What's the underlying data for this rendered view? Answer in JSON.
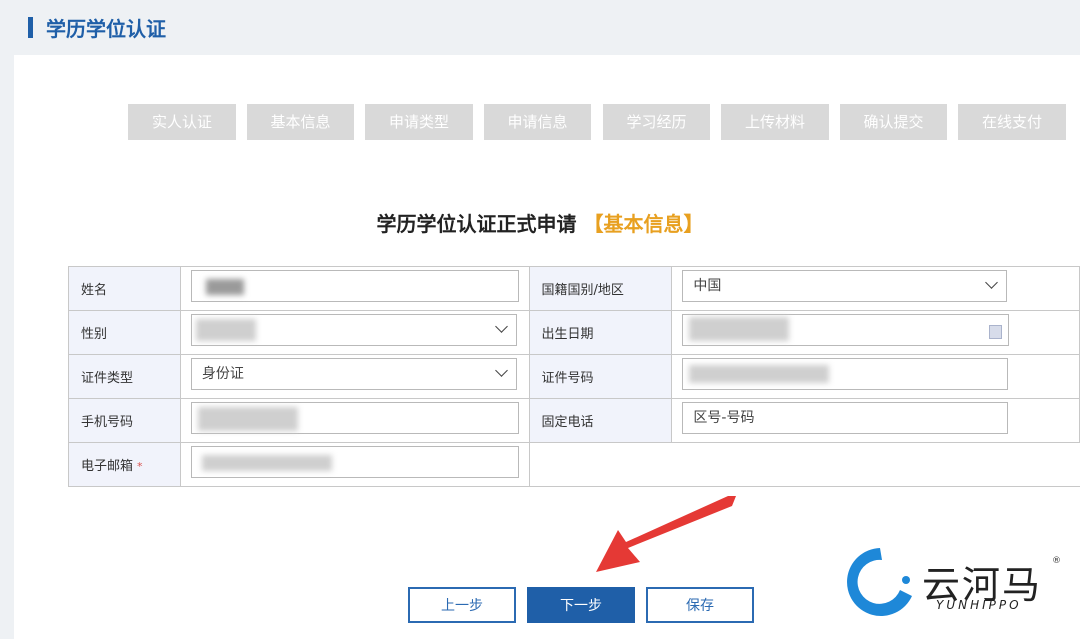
{
  "header": {
    "title": "学历学位认证"
  },
  "steps": [
    "实人认证",
    "基本信息",
    "申请类型",
    "申请信息",
    "学习经历",
    "上传材料",
    "确认提交",
    "在线支付"
  ],
  "form_title": {
    "main": "学历学位认证正式申请",
    "sub": "【基本信息】"
  },
  "fields": {
    "name": {
      "label": "姓名"
    },
    "nationality": {
      "label": "国籍国别/地区",
      "value": "中国"
    },
    "gender": {
      "label": "性别"
    },
    "birthdate": {
      "label": "出生日期"
    },
    "id_type": {
      "label": "证件类型",
      "value": "身份证"
    },
    "id_number": {
      "label": "证件号码"
    },
    "mobile": {
      "label": "手机号码"
    },
    "phone": {
      "label": "固定电话",
      "placeholder": "区号-号码"
    },
    "email": {
      "label": "电子邮箱",
      "required_mark": "*"
    }
  },
  "buttons": {
    "prev": "上一步",
    "next": "下一步",
    "save": "保存"
  },
  "logo": {
    "cn": "云河马",
    "en": "YUNHIPPO",
    "reg": "®"
  },
  "colors": {
    "brand": "#1f5fa8",
    "accent": "#e8a020",
    "arrow": "#e53935",
    "step_inactive": "#d9d9d9"
  }
}
